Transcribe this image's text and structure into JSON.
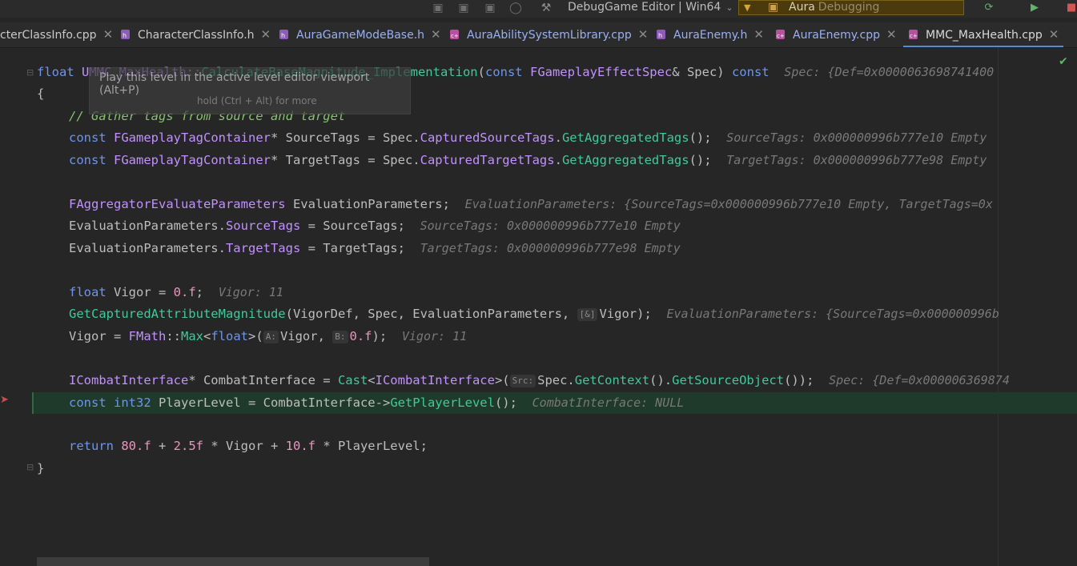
{
  "toolbar": {
    "icons": [
      "gamepad-icon",
      "gamepad-icon",
      "gamepad-icon",
      "unreal-icon",
      "hammer-icon"
    ],
    "config_label": "DebugGame Editor | Win64",
    "run_target": "Aura",
    "run_status": "Debugging",
    "colors": {
      "run_bg": "#4a3a0c",
      "accent": "#d4a933"
    }
  },
  "tabs": [
    {
      "label": "cterClassInfo.cpp",
      "type": "cpp",
      "active": false
    },
    {
      "label": "CharacterClassInfo.h",
      "type": "h",
      "active": false
    },
    {
      "label": "AuraGameModeBase.h",
      "type": "h",
      "active": false
    },
    {
      "label": "AuraAbilitySystemLibrary.cpp",
      "type": "cpp",
      "active": false
    },
    {
      "label": "AuraEnemy.h",
      "type": "h",
      "active": false
    },
    {
      "label": "AuraEnemy.cpp",
      "type": "cpp",
      "active": false
    },
    {
      "label": "MMC_MaxHealth.cpp",
      "type": "cpp",
      "active": true
    }
  ],
  "tooltip": {
    "text": "Play this level in the active level editor viewport (Alt+P)",
    "shortcut": "hold (Ctrl + Alt) for more"
  },
  "code": {
    "l1": {
      "kw": "float",
      "cls": "UMMC_MaxHealth",
      "sep": "::",
      "fn": "CalculateBaseMagnitude_Implementation",
      "p1": "(",
      "kw2": "const",
      "ty": "FGameplayEffectSpec",
      "rest": "& Spec) ",
      "kw3": "const",
      "hint": "Spec: {Def=0x0000063698741400"
    },
    "l2": {
      "brace": "{"
    },
    "l3": {
      "comment": "// Gather tags from source and target"
    },
    "l4": {
      "kw": "const",
      "ty": "FGameplayTagContainer",
      "a": "* SourceTags = Spec.",
      "m": "CapturedSourceTags",
      "dot": ".",
      "fn": "GetAggregatedTags",
      "end": "();",
      "hint": "SourceTags: 0x000000996b777e10 Empty"
    },
    "l5": {
      "kw": "const",
      "ty": "FGameplayTagContainer",
      "a": "* TargetTags = Spec.",
      "m": "CapturedTargetTags",
      "dot": ".",
      "fn": "GetAggregatedTags",
      "end": "();",
      "hint": "TargetTags: 0x000000996b777e98 Empty"
    },
    "l6": {
      "ty": "FAggregatorEvaluateParameters",
      "a": " EvaluationParameters;",
      "hint": "EvaluationParameters: {SourceTags=0x000000996b777e10 Empty, TargetTags=0x"
    },
    "l7": {
      "a": "EvaluationParameters.",
      "m": "SourceTags",
      "b": " = SourceTags;",
      "hint": "SourceTags: 0x000000996b777e10 Empty"
    },
    "l8": {
      "a": "EvaluationParameters.",
      "m": "TargetTags",
      "b": " = TargetTags;",
      "hint": "TargetTags: 0x000000996b777e98 Empty"
    },
    "l9": {
      "kw": "float",
      "a": " Vigor = ",
      "num": "0.f",
      "b": ";",
      "hint": "Vigor: 11"
    },
    "l10": {
      "fn": "GetCapturedAttributeMagnitude",
      "a": "(VigorDef, Spec, EvaluationParameters, ",
      "badge": "[&]",
      "b": "Vigor);",
      "hint": "EvaluationParameters: {SourceTags=0x000000996b"
    },
    "l11": {
      "a": "Vigor = ",
      "ty": "FMath",
      "sep": "::",
      "fn": "Max",
      "lt": "<",
      "kw": "float",
      "gt": ">(",
      "badgeA": "A:",
      "b": "Vigor, ",
      "badgeB": "B:",
      "num": "0.f",
      "c": ");",
      "hint": "Vigor: 11"
    },
    "l12": {
      "ty": "ICombatInterface",
      "a": "* CombatInterface = ",
      "fn": "Cast",
      "lt": "<",
      "ty2": "ICombatInterface",
      "gt": ">(",
      "badge": "Src:",
      "b": "Spec.",
      "fn2": "GetContext",
      "c": "().",
      "fn3": "GetSourceObject",
      "d": "());",
      "hint": "Spec: {Def=0x000006369874"
    },
    "l13": {
      "kw": "const",
      "ty": "int32",
      "a": " PlayerLevel = CombatInterface->",
      "fn": "GetPlayerLevel",
      "b": "();",
      "hint": "CombatInterface: NULL"
    },
    "l14": {
      "kw": "return",
      "n1": "80.f",
      "a": " + ",
      "n2": "2.5f",
      "b": " * Vigor + ",
      "n3": "10.f",
      "c": " * PlayerLevel;"
    },
    "l15": {
      "brace": "}"
    }
  }
}
